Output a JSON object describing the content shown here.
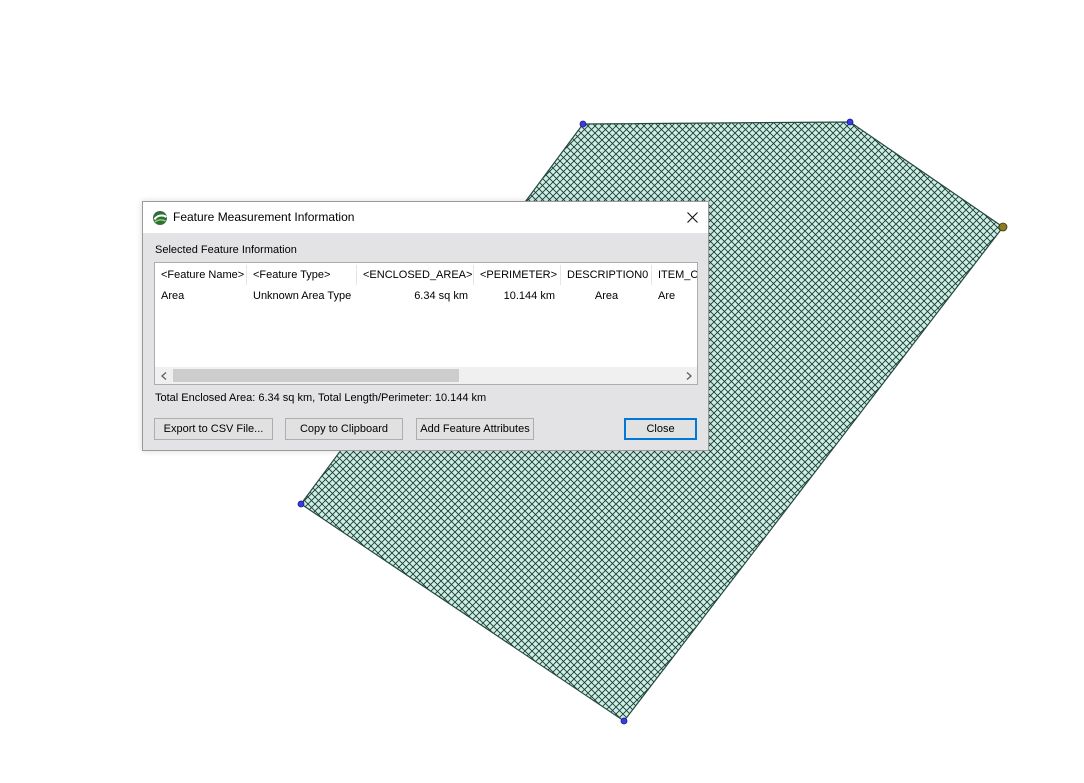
{
  "map": {
    "fill_color": "#cdeee5",
    "hatch_color": "#1b3a33",
    "outline_color": "#24493e",
    "vertex_color": "#2a2adf"
  },
  "dialog": {
    "title": "Feature Measurement Information",
    "group_label": "Selected Feature Information",
    "columns": [
      "<Feature Name>",
      "<Feature Type>",
      "<ENCLOSED_AREA>",
      "<PERIMETER>",
      "DESCRIPTION0",
      "ITEM_C"
    ],
    "rows": [
      [
        "Area",
        "Unknown Area Type",
        "6.34 sq km",
        "10.144 km",
        "Area",
        "Are"
      ]
    ],
    "totals": "Total Enclosed Area: 6.34 sq km, Total Length/Perimeter: 10.144 km",
    "buttons": {
      "export_csv": "Export to CSV File...",
      "copy_clipboard": "Copy to Clipboard",
      "add_attributes": "Add Feature Attributes",
      "close": "Close"
    }
  }
}
